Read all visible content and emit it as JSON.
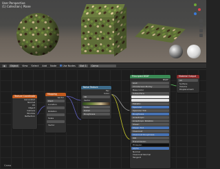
{
  "viewport": {
    "header_line1": "User Perspective",
    "header_line2": "(1) Collection | Plane"
  },
  "editor_header": {
    "items": [
      "Object",
      "View",
      "Select",
      "Add",
      "Node",
      "Use Nodes",
      "Slot 1",
      "Camo"
    ]
  },
  "nodes": {
    "texcoord": {
      "title": "Texture Coordinate",
      "rows": [
        "Generated",
        "Normal",
        "UV",
        "Object",
        "Camera",
        "Window",
        "Reflection"
      ]
    },
    "mapping": {
      "title": "Mapping",
      "rows": [
        "Vector",
        "Point",
        "Location",
        "Rotation",
        "Scale",
        "Vector"
      ]
    },
    "noise": {
      "title": "Noise Texture",
      "rows": [
        "Fac",
        "Color",
        "3D",
        "Vector",
        "Scale",
        "Detail",
        "Roughness",
        "Distortion"
      ]
    },
    "colorramp": {
      "title": "ColorRamp",
      "rows": [
        "Color",
        "Alpha",
        "RGB",
        "Linear",
        "Fac"
      ]
    },
    "bsdf": {
      "title": "Principled BSDF",
      "rows": [
        "BSDF",
        "GGX",
        "Christensen-Burley",
        "Base Color",
        "Subsurface",
        "Subsurface Radius",
        "Subsurface Color",
        "Metallic",
        "Specular",
        "Specular Tint",
        "Roughness",
        "Anisotropic",
        "Anisotropic Rotation",
        "Sheen",
        "Sheen Tint",
        "Clearcoat",
        "Clearcoat Roughness",
        "IOR",
        "Transmission",
        "Emission",
        "Alpha",
        "Normal",
        "Clearcoat Normal",
        "Tangent"
      ]
    },
    "output": {
      "title": "Material Output",
      "rows": [
        "All",
        "Surface",
        "Volume",
        "Displacement"
      ]
    }
  },
  "frame_label": "Camo"
}
